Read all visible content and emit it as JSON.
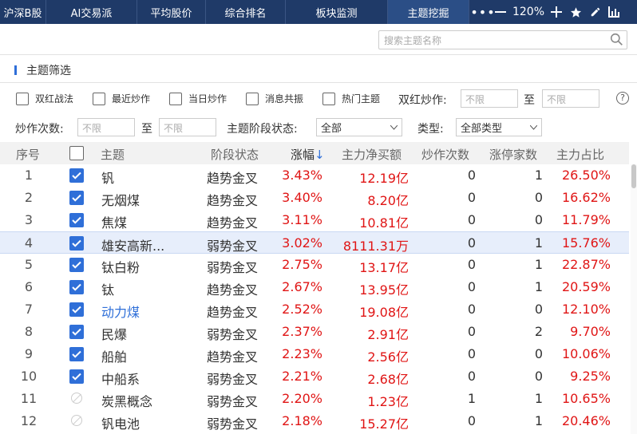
{
  "tabs": [
    {
      "label": "沪深B股"
    },
    {
      "label": "AI交易派"
    },
    {
      "label": "平均股价"
    },
    {
      "label": "综合排名"
    },
    {
      "label": "板块监测"
    },
    {
      "label": "主题挖掘"
    }
  ],
  "toolbar": {
    "more_icon": "more-icon",
    "zoom": "120%"
  },
  "search": {
    "placeholder": "搜索主题名称"
  },
  "section": {
    "title": "主题筛选"
  },
  "filters": {
    "checkboxes": [
      "双红战法",
      "最近炒作",
      "当日炒作",
      "消息共振",
      "热门主题"
    ],
    "dual_red_label": "双红炒作:",
    "unlimited": "不限",
    "to": "至",
    "hype_count_label": "炒作次数:",
    "stage_label": "主题阶段状态:",
    "stage_value": "全部",
    "type_label": "类型:",
    "type_value": "全部类型"
  },
  "table": {
    "headers": [
      "序号",
      "主题",
      "阶段状态",
      "涨幅",
      "主力净买额",
      "炒作次数",
      "涨停家数",
      "主力占比"
    ],
    "sort_arrow": "↓",
    "rows": [
      {
        "idx": "1",
        "checked": true,
        "name": "钒",
        "stage": "趋势金叉",
        "change": "3.43%",
        "net": "12.19亿",
        "hype": "0",
        "limit": "1",
        "ratio": "26.50%"
      },
      {
        "idx": "2",
        "checked": true,
        "name": "无烟煤",
        "stage": "趋势金叉",
        "change": "3.40%",
        "net": "8.20亿",
        "hype": "0",
        "limit": "0",
        "ratio": "16.62%"
      },
      {
        "idx": "3",
        "checked": true,
        "name": "焦煤",
        "stage": "趋势金叉",
        "change": "3.11%",
        "net": "10.81亿",
        "hype": "0",
        "limit": "0",
        "ratio": "11.79%"
      },
      {
        "idx": "4",
        "checked": true,
        "name": "雄安高新...",
        "stage": "弱势金叉",
        "change": "3.02%",
        "net": "8111.31万",
        "hype": "0",
        "limit": "1",
        "ratio": "15.76%"
      },
      {
        "idx": "5",
        "checked": true,
        "name": "钛白粉",
        "stage": "弱势金叉",
        "change": "2.75%",
        "net": "13.17亿",
        "hype": "0",
        "limit": "1",
        "ratio": "22.87%"
      },
      {
        "idx": "6",
        "checked": true,
        "name": "钛",
        "stage": "趋势金叉",
        "change": "2.67%",
        "net": "13.95亿",
        "hype": "0",
        "limit": "1",
        "ratio": "20.59%"
      },
      {
        "idx": "7",
        "checked": true,
        "name": "动力煤",
        "stage": "趋势金叉",
        "change": "2.52%",
        "net": "19.08亿",
        "hype": "0",
        "limit": "0",
        "ratio": "12.10%"
      },
      {
        "idx": "8",
        "checked": true,
        "name": "民爆",
        "stage": "弱势金叉",
        "change": "2.37%",
        "net": "2.91亿",
        "hype": "0",
        "limit": "2",
        "ratio": "9.70%"
      },
      {
        "idx": "9",
        "checked": true,
        "name": "船舶",
        "stage": "趋势金叉",
        "change": "2.23%",
        "net": "2.56亿",
        "hype": "0",
        "limit": "0",
        "ratio": "10.06%"
      },
      {
        "idx": "10",
        "checked": true,
        "name": "中船系",
        "stage": "弱势金叉",
        "change": "2.21%",
        "net": "2.68亿",
        "hype": "0",
        "limit": "0",
        "ratio": "9.25%"
      },
      {
        "idx": "11",
        "checked": false,
        "name": "炭黑概念",
        "stage": "弱势金叉",
        "change": "2.20%",
        "net": "1.23亿",
        "hype": "1",
        "limit": "1",
        "ratio": "10.65%"
      },
      {
        "idx": "12",
        "checked": false,
        "name": "钒电池",
        "stage": "弱势金叉",
        "change": "2.18%",
        "net": "15.27亿",
        "hype": "0",
        "limit": "1",
        "ratio": "20.46%"
      }
    ]
  },
  "colors": {
    "accent": "#2f6fd8",
    "red": "#e01515",
    "tabbar": "#1f3a68",
    "link": "#2f6fd8"
  }
}
